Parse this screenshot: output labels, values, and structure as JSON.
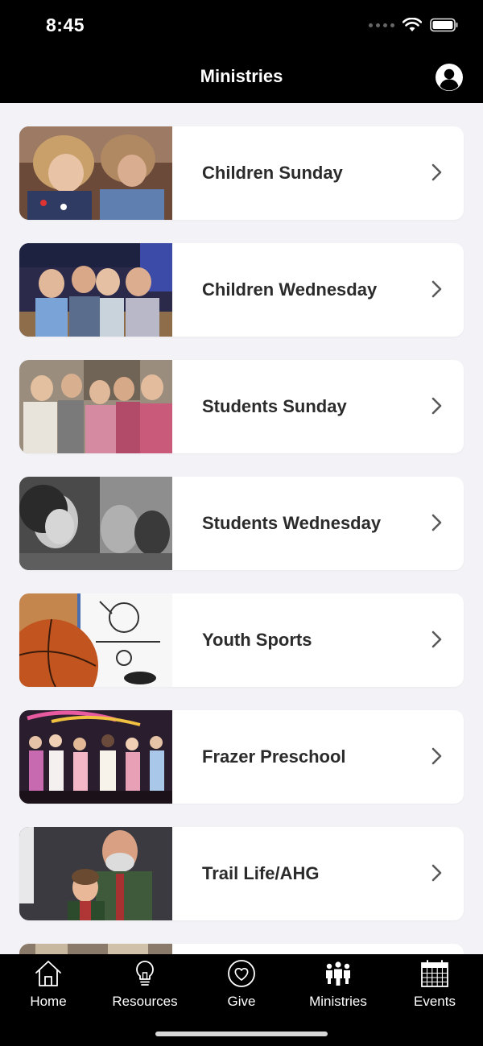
{
  "status_bar": {
    "time": "8:45"
  },
  "nav": {
    "title": "Ministries"
  },
  "ministries": [
    {
      "label": "Children Sunday"
    },
    {
      "label": "Children Wednesday"
    },
    {
      "label": "Students Sunday"
    },
    {
      "label": "Students Wednesday"
    },
    {
      "label": "Youth Sports"
    },
    {
      "label": "Frazer Preschool"
    },
    {
      "label": "Trail Life/AHG"
    }
  ],
  "tabs": [
    {
      "label": "Home",
      "icon": "house-icon"
    },
    {
      "label": "Resources",
      "icon": "lightbulb-icon"
    },
    {
      "label": "Give",
      "icon": "heart-icon"
    },
    {
      "label": "Ministries",
      "icon": "people-icon"
    },
    {
      "label": "Events",
      "icon": "calendar-icon"
    }
  ],
  "colors": {
    "bar_background": "#000000",
    "page_background": "#f2f2f7",
    "card_text": "#2b2b2b"
  }
}
